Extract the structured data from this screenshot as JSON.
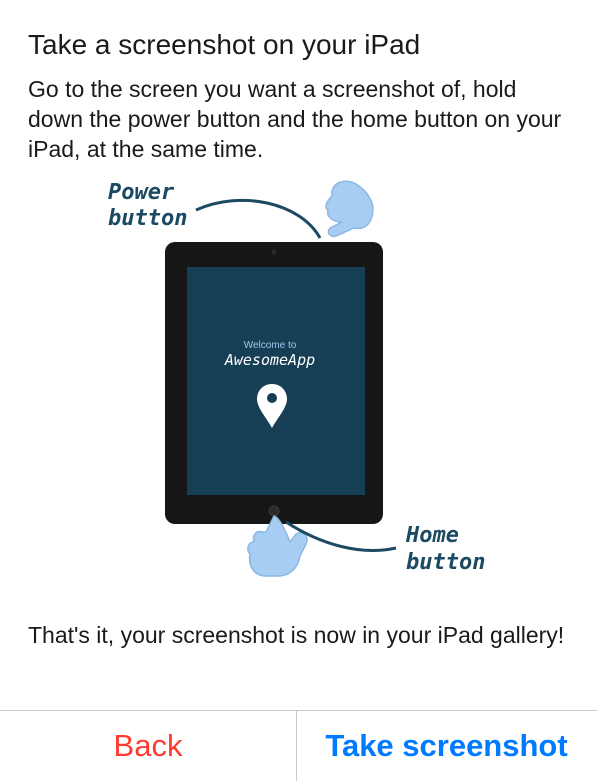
{
  "dialog": {
    "title": "Take a screenshot on your iPad",
    "instructions": "Go to the screen you want a screenshot of, hold down the power button and the home button on your iPad, at the same time.",
    "footer": "That's it, your screenshot is now in your iPad gallery!"
  },
  "illustration": {
    "power_label_line1": "Power",
    "power_label_line2": "button",
    "home_label_line1": "Home",
    "home_label_line2": "button",
    "screen_welcome": "Welcome to",
    "screen_app_name": "AwesomeApp"
  },
  "buttons": {
    "back_label": "Back",
    "take_screenshot_label": "Take screenshot"
  },
  "colors": {
    "back": "#ff3b30",
    "primary": "#007aff",
    "screen": "#163f56",
    "ink": "#1d4a63",
    "hand": "#a8cdf2"
  }
}
